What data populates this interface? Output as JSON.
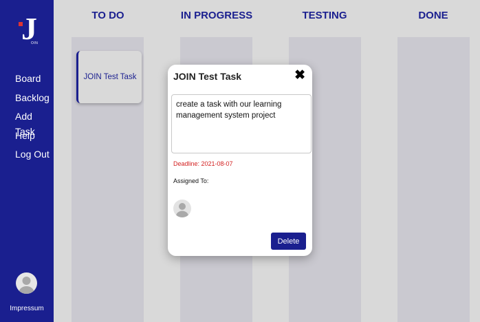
{
  "sidebar": {
    "logo_text": "J",
    "logo_sub": "OIN",
    "items": [
      {
        "label": "Board"
      },
      {
        "label": "Backlog"
      },
      {
        "label": "Add Task"
      },
      {
        "label": "Help"
      },
      {
        "label": "Log Out"
      }
    ],
    "footer_link": "Impressum"
  },
  "board": {
    "columns": [
      {
        "title": "TO DO"
      },
      {
        "title": "IN PROGRESS"
      },
      {
        "title": "TESTING"
      },
      {
        "title": "DONE"
      }
    ],
    "cards": [
      {
        "title": "JOIN Test Task"
      }
    ]
  },
  "modal": {
    "title": "JOIN Test Task",
    "close_symbol": "✖",
    "description": "create a task with our learning management system project",
    "deadline": "Deadline: 2021-08-07",
    "assigned_label": "Assigned To:",
    "delete_label": "Delete"
  },
  "colors": {
    "primary": "#1a1f8f",
    "deadline": "#d32020",
    "background": "#d9d9d9",
    "column": "#cac9d0"
  }
}
